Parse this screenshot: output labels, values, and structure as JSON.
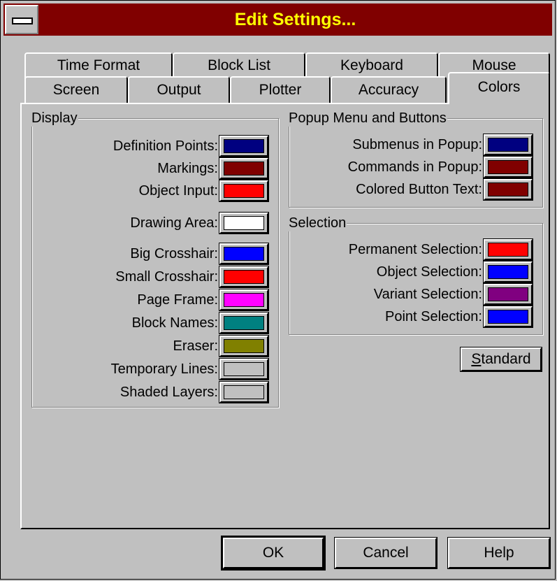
{
  "window": {
    "title": "Edit Settings..."
  },
  "tabs": {
    "back_row": [
      "Time Format",
      "Block List",
      "Keyboard",
      "Mouse"
    ],
    "front_row": [
      "Screen",
      "Output",
      "Plotter",
      "Accuracy",
      "Colors"
    ],
    "active": "Colors"
  },
  "display": {
    "title": "Display",
    "items": [
      {
        "label": "Definition Points:",
        "color": "#000080"
      },
      {
        "label": "Markings:",
        "color": "#800000"
      },
      {
        "label": "Object Input:",
        "color": "#ff0000"
      },
      {
        "label": "Drawing Area:",
        "color": "#ffffff"
      },
      {
        "label": "Big Crosshair:",
        "color": "#0000ff"
      },
      {
        "label": "Small Crosshair:",
        "color": "#ff0000"
      },
      {
        "label": "Page Frame:",
        "color": "#ff00ff"
      },
      {
        "label": "Block Names:",
        "color": "#008080"
      },
      {
        "label": "Eraser:",
        "color": "#808000"
      },
      {
        "label": "Temporary Lines:",
        "color": "#c0c0c0"
      },
      {
        "label": "Shaded Layers:",
        "color": "#c0c0c0"
      }
    ]
  },
  "popup": {
    "title": "Popup Menu and Buttons",
    "items": [
      {
        "label": "Submenus in Popup:",
        "color": "#000080"
      },
      {
        "label": "Commands in Popup:",
        "color": "#800000"
      },
      {
        "label": "Colored Button Text:",
        "color": "#800000"
      }
    ]
  },
  "selection": {
    "title": "Selection",
    "items": [
      {
        "label": "Permanent Selection:",
        "color": "#ff0000"
      },
      {
        "label": "Object Selection:",
        "color": "#0000ff"
      },
      {
        "label": "Variant Selection:",
        "color": "#800080"
      },
      {
        "label": "Point Selection:",
        "color": "#0000ff"
      }
    ]
  },
  "buttons": {
    "standard_first": "S",
    "standard_rest": "tandard",
    "ok": "OK",
    "cancel": "Cancel",
    "help": "Help"
  }
}
